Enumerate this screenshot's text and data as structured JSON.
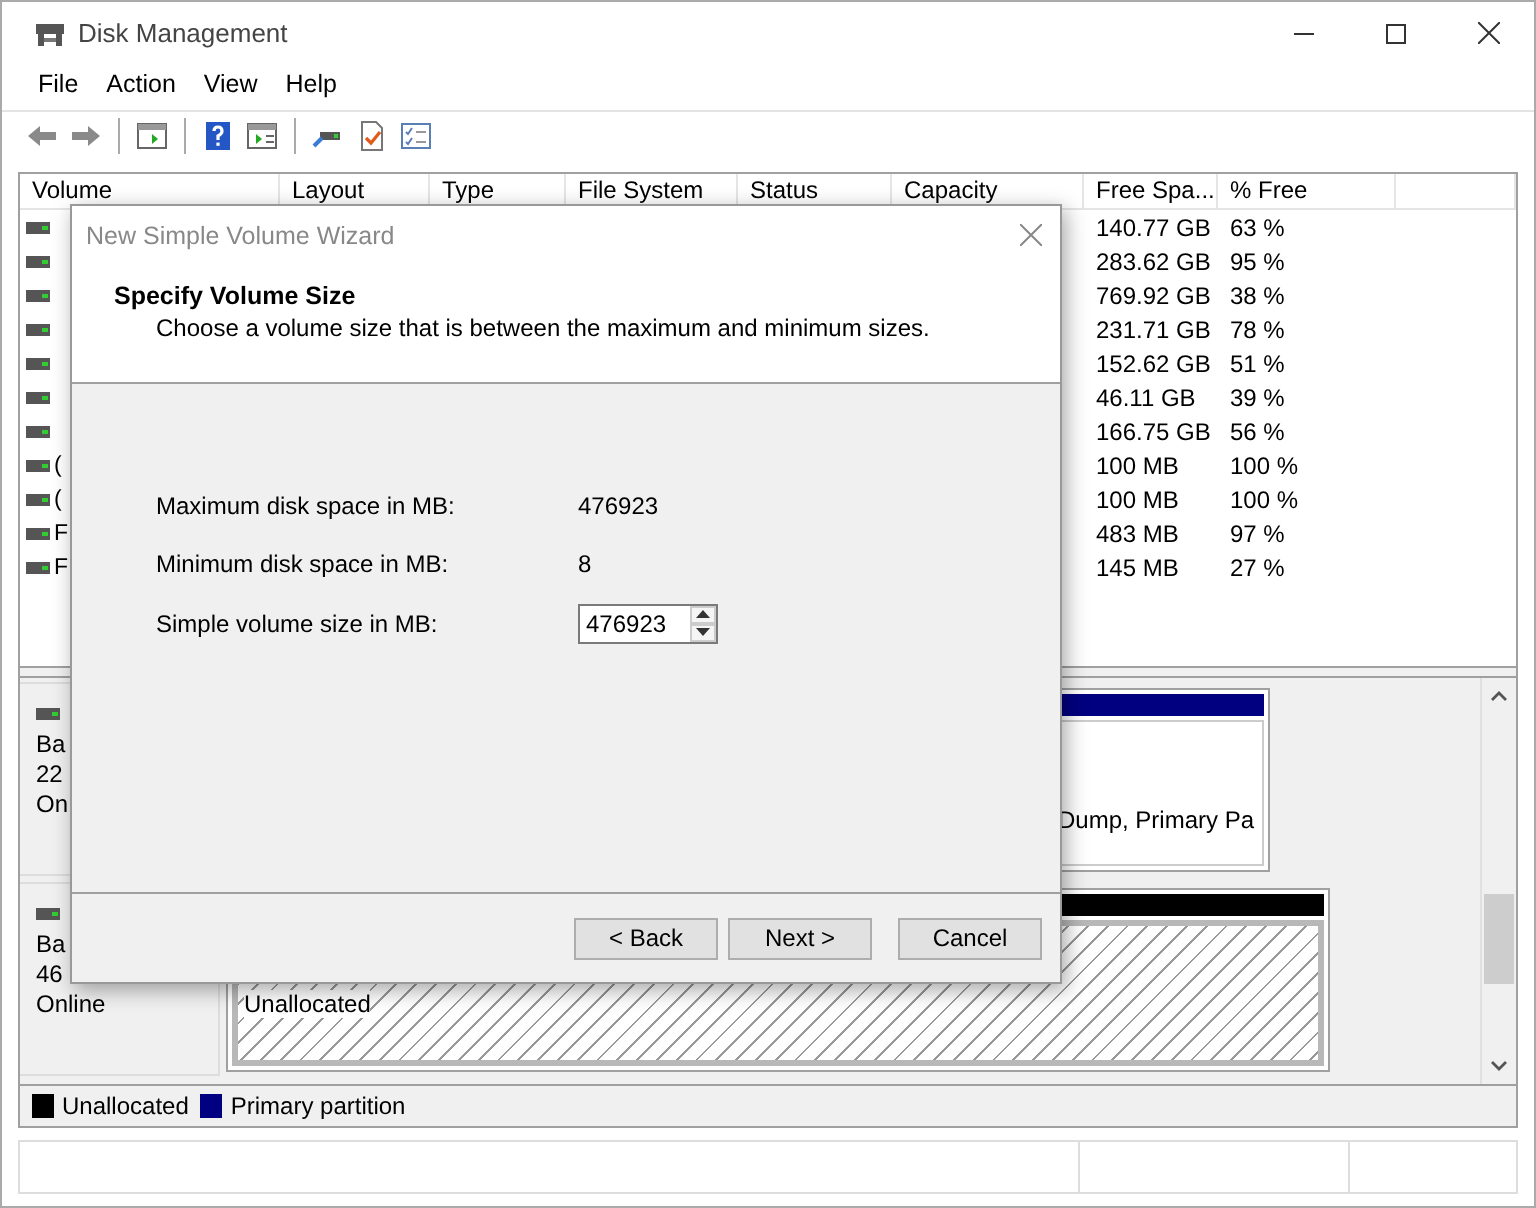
{
  "window": {
    "title": "Disk Management"
  },
  "menu": [
    "File",
    "Action",
    "View",
    "Help"
  ],
  "volume_list": {
    "columns": [
      "Volume",
      "Layout",
      "Type",
      "File System",
      "Status",
      "Capacity",
      "Free Spa...",
      "% Free"
    ],
    "rows": [
      {
        "free_space": "140.77 GB",
        "percent_free": "63 %"
      },
      {
        "free_space": "283.62 GB",
        "percent_free": "95 %"
      },
      {
        "free_space": "769.92 GB",
        "percent_free": "38 %"
      },
      {
        "free_space": "231.71 GB",
        "percent_free": "78 %"
      },
      {
        "free_space": "152.62 GB",
        "percent_free": "51 %"
      },
      {
        "free_space": "46.11 GB",
        "percent_free": "39 %"
      },
      {
        "free_space": "166.75 GB",
        "percent_free": "56 %"
      },
      {
        "volume": "(",
        "free_space": "100 MB",
        "percent_free": "100 %"
      },
      {
        "volume": "(",
        "free_space": "100 MB",
        "percent_free": "100 %"
      },
      {
        "volume": "F",
        "free_space": "483 MB",
        "percent_free": "97 %"
      },
      {
        "volume": "F",
        "free_space": "145 MB",
        "percent_free": "27 %"
      }
    ]
  },
  "disks": [
    {
      "label_lines": [
        "Ba",
        "22",
        "On"
      ],
      "partitions": [
        {
          "kind": "primary",
          "text": "Dump, Primary Pa"
        }
      ]
    },
    {
      "label_lines": [
        "Ba",
        "46",
        "Online"
      ],
      "partitions": [
        {
          "kind": "unallocated",
          "text": "Unallocated"
        }
      ]
    }
  ],
  "legend": [
    {
      "label": "Unallocated",
      "color": "#000000"
    },
    {
      "label": "Primary partition",
      "color": "#000080"
    }
  ],
  "dialog": {
    "title": "New Simple Volume Wizard",
    "heading": "Specify Volume Size",
    "subtitle": "Choose a volume size that is between the maximum and minimum sizes.",
    "fields": [
      {
        "kind": "text",
        "label": "Maximum disk space in MB:",
        "value": "476923"
      },
      {
        "kind": "text",
        "label": "Minimum disk space in MB:",
        "value": "8"
      },
      {
        "kind": "spinner",
        "label": "Simple volume size in MB:",
        "value": "476923"
      }
    ],
    "buttons": [
      "< Back",
      "Next >",
      "Cancel"
    ]
  }
}
